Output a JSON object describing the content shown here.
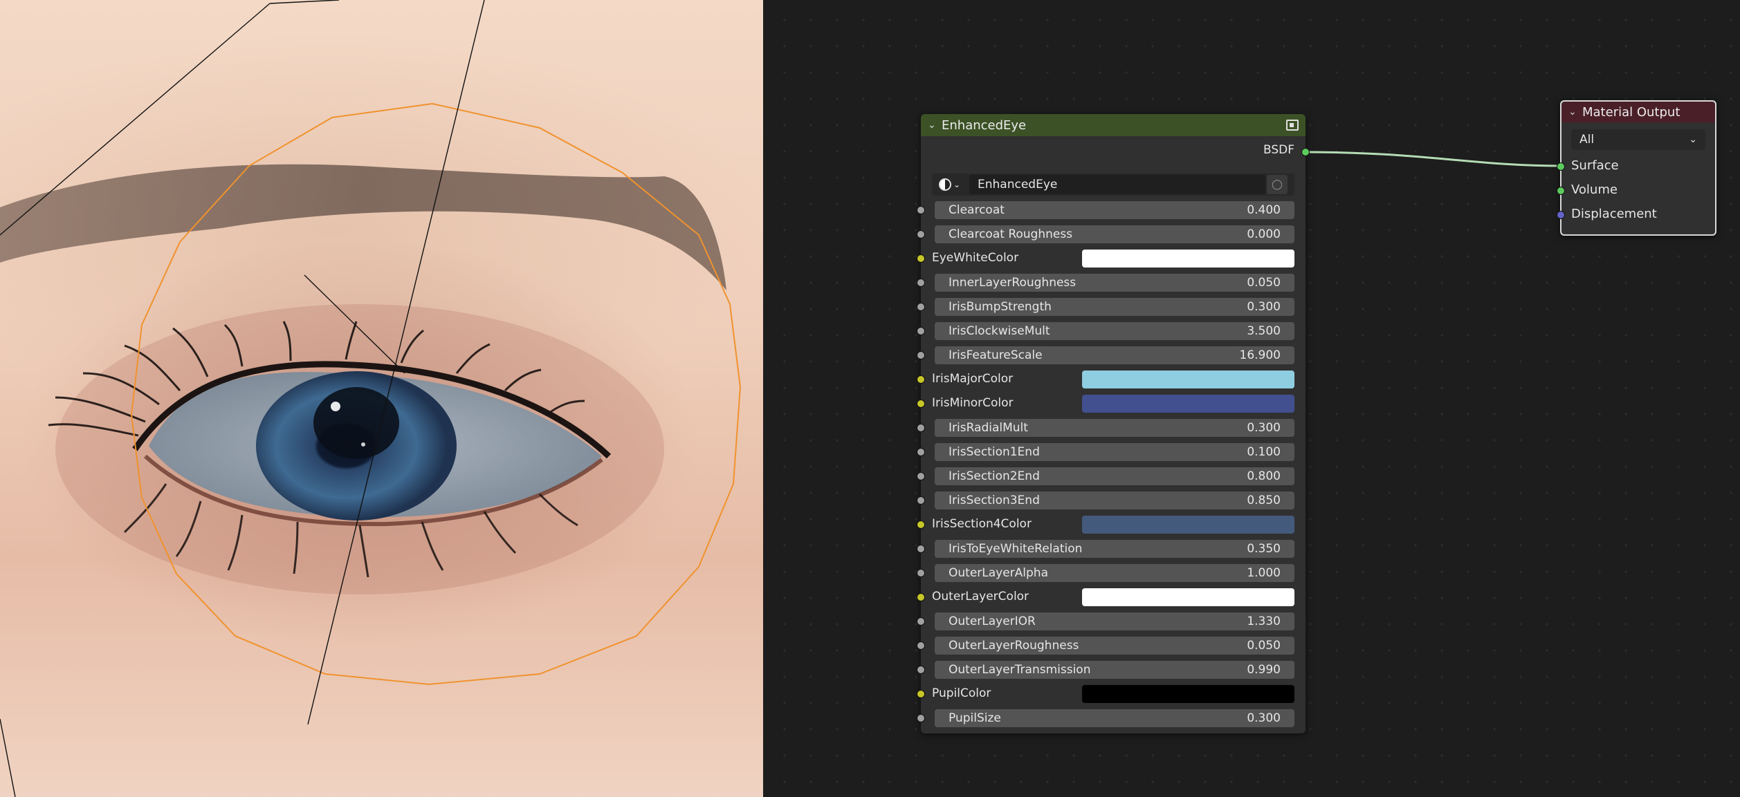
{
  "viewport": {
    "description_icon": "eye-render"
  },
  "group_node": {
    "title": "EnhancedEye",
    "header_icon": "node-group-icon",
    "output_socket": "BSDF",
    "material_name": "EnhancedEye",
    "inputs": [
      {
        "label": "Clearcoat",
        "kind": "value",
        "value": "0.400"
      },
      {
        "label": "Clearcoat Roughness",
        "kind": "value",
        "value": "0.000"
      },
      {
        "label": "EyeWhiteColor",
        "kind": "color",
        "color": "#ffffff"
      },
      {
        "label": "InnerLayerRoughness",
        "kind": "value",
        "value": "0.050"
      },
      {
        "label": "IrisBumpStrength",
        "kind": "value",
        "value": "0.300"
      },
      {
        "label": "IrisClockwiseMult",
        "kind": "value",
        "value": "3.500"
      },
      {
        "label": "IrisFeatureScale",
        "kind": "value",
        "value": "16.900"
      },
      {
        "label": "IrisMajorColor",
        "kind": "color",
        "color": "#8fcde0"
      },
      {
        "label": "IrisMinorColor",
        "kind": "color",
        "color": "#42508f"
      },
      {
        "label": "IrisRadialMult",
        "kind": "value",
        "value": "0.300"
      },
      {
        "label": "IrisSection1End",
        "kind": "value",
        "value": "0.100"
      },
      {
        "label": "IrisSection2End",
        "kind": "value",
        "value": "0.800"
      },
      {
        "label": "IrisSection3End",
        "kind": "value",
        "value": "0.850"
      },
      {
        "label": "IrisSection4Color",
        "kind": "color",
        "color": "#445a7c"
      },
      {
        "label": "IrisToEyeWhiteRelation",
        "kind": "value",
        "value": "0.350"
      },
      {
        "label": "OuterLayerAlpha",
        "kind": "value",
        "value": "1.000"
      },
      {
        "label": "OuterLayerColor",
        "kind": "color",
        "color": "#ffffff"
      },
      {
        "label": "OuterLayerIOR",
        "kind": "value",
        "value": "1.330"
      },
      {
        "label": "OuterLayerRoughness",
        "kind": "value",
        "value": "0.050"
      },
      {
        "label": "OuterLayerTransmission",
        "kind": "value",
        "value": "0.990"
      },
      {
        "label": "PupilColor",
        "kind": "color",
        "color": "#000000"
      },
      {
        "label": "PupilSize",
        "kind": "value",
        "value": "0.300"
      }
    ]
  },
  "output_node": {
    "title": "Material Output",
    "target": "All",
    "sockets": [
      {
        "label": "Surface",
        "socket_color": "#5dca5d"
      },
      {
        "label": "Volume",
        "socket_color": "#5dca5d"
      },
      {
        "label": "Displacement",
        "socket_color": "#6363c7"
      }
    ]
  },
  "colors": {
    "group_header": "#3c5226",
    "output_header": "#4a1f28",
    "link": "#b5dcb5",
    "selection_outline": "#f0922e"
  }
}
